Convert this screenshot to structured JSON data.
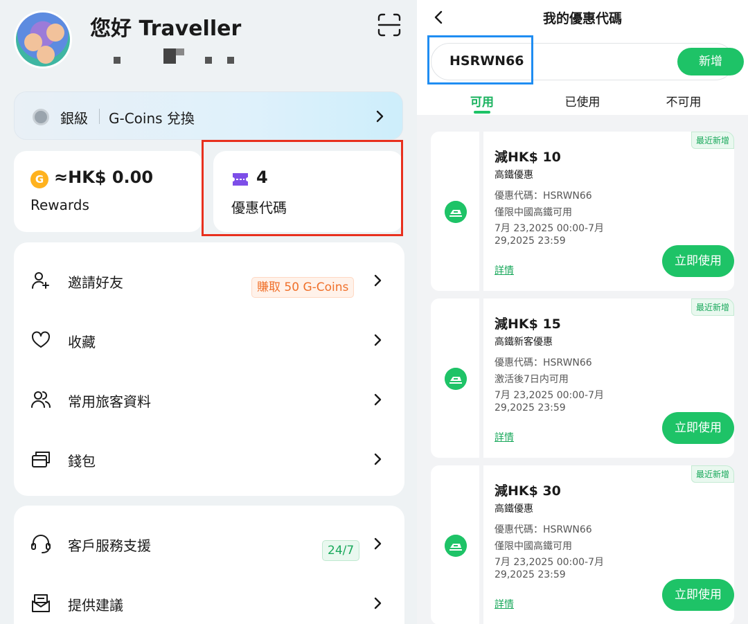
{
  "profile": {
    "greeting": "您好 Traveller"
  },
  "tier": {
    "level": "銀級",
    "link": "G-Coins 兌換"
  },
  "rewards": {
    "amount": "≈HK$ 0.00",
    "label": "Rewards"
  },
  "promo": {
    "count": "4",
    "label": "優惠代碼"
  },
  "menu": [
    {
      "label": "邀請好友",
      "badge": "賺取 50 G-Coins"
    },
    {
      "label": "收藏"
    },
    {
      "label": "常用旅客資料"
    },
    {
      "label": "錢包"
    }
  ],
  "menu2": [
    {
      "label": "客戶服務支援",
      "badge": "24/7"
    },
    {
      "label": "提供建議"
    }
  ],
  "promo_page": {
    "title": "我的優惠代碼",
    "code_value": "HSRWN66",
    "add_label": "新增",
    "tabs": [
      "可用",
      "已使用",
      "不可用"
    ]
  },
  "coupons": [
    {
      "badge": "最近新增",
      "title": "減HK$ 10",
      "subtitle": "高鐵優惠",
      "code": "優惠代碼：HSRWN66",
      "condition": "僅限中國高鐵可用",
      "validity_1": "7月 23,2025 00:00-7月",
      "validity_2": "29,2025 23:59",
      "detail": "詳情",
      "use": "立即使用"
    },
    {
      "badge": "最近新增",
      "title": "減HK$ 15",
      "subtitle": "高鐵新客優惠",
      "code": "優惠代碼：HSRWN66",
      "condition": "激活後7日内可用",
      "validity_1": "7月 23,2025 00:00-7月",
      "validity_2": "29,2025 23:59",
      "detail": "詳情",
      "use": "立即使用"
    },
    {
      "badge": "最近新增",
      "title": "減HK$ 30",
      "subtitle": "高鐵優惠",
      "code": "優惠代碼：HSRWN66",
      "condition": "僅限中國高鐵可用",
      "validity_1": "7月 23,2025 00:00-7月",
      "validity_2": "29,2025 23:59",
      "detail": "詳情",
      "use": "立即使用"
    }
  ],
  "colors": {
    "accent_green": "#1ec367",
    "highlight_red": "#e8301e",
    "highlight_blue": "#1f8df2",
    "badge_orange": "#f0702a"
  }
}
